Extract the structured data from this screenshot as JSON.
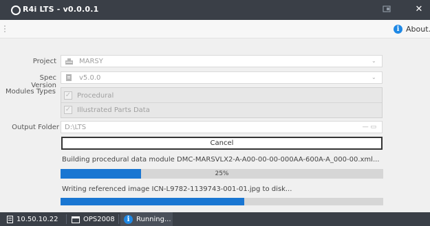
{
  "window": {
    "title": "R4i LTS - v0.0.0.1"
  },
  "toolbar": {
    "about_label": "About..."
  },
  "form": {
    "project_label": "Project",
    "project_value": "MARSY",
    "spec_label": "Spec Version",
    "spec_value": "v5.0.0",
    "modules_label": "Modules Types",
    "modules": [
      {
        "label": "Procedural",
        "checked": true
      },
      {
        "label": "Illustrated Parts Data",
        "checked": true
      }
    ],
    "output_label": "Output Folder",
    "output_value": "D:\\LTS",
    "output_browse": "— ▭"
  },
  "actions": {
    "cancel_label": "Cancel"
  },
  "progress": {
    "task1_text": "Building procedural data module DMC-MARSVLX2-A-A00-00-00-000AA-600A-A_000-00.xml...",
    "task1_percent_label": "25%",
    "task1_fraction": 0.25,
    "task2_text": "Writing referenced image ICN-L9782-1139743-001-01.jpg to disk...",
    "task2_fraction": 0.57
  },
  "statusbar": {
    "ip": "10.50.10.22",
    "server": "OPS2008",
    "state": "Running..."
  },
  "colors": {
    "titlebar": "#3a3f47",
    "progress_fill": "#1976d2",
    "info_blue": "#1e88e5"
  }
}
